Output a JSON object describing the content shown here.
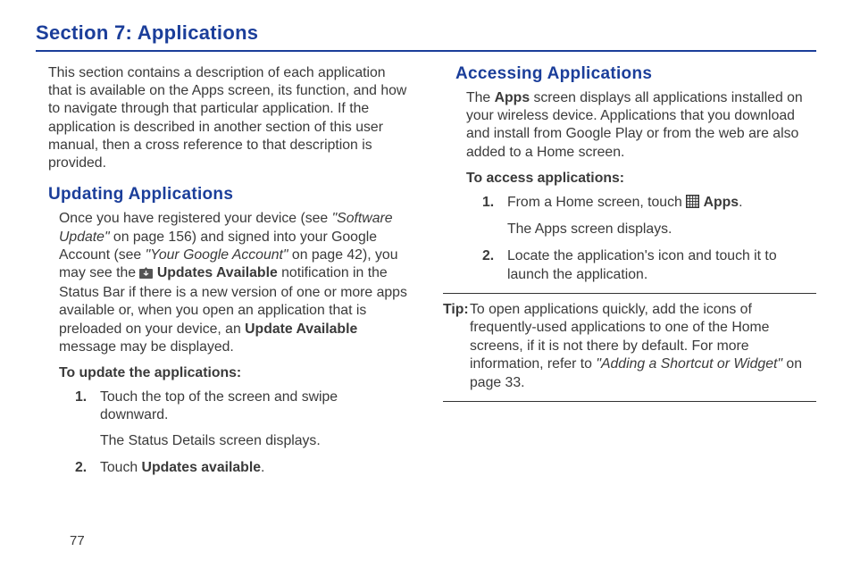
{
  "pageTitle": "Section 7: Applications",
  "intro": "This section contains a description of each application that is available on the Apps screen, its function, and how to navigate through that particular application. If the application is described in another section of this user manual, then a cross reference to that description is provided.",
  "left": {
    "heading": "Updating Applications",
    "para": {
      "seg1": "Once you have registered your device (see ",
      "ref1": "\"Software Update\"",
      "seg2": " on page 156) and signed into your Google Account (see ",
      "ref2": "\"Your Google Account\"",
      "seg3": " on page 42), you may see the ",
      "bold1": "Updates Available",
      "seg4": " notification in the Status Bar if there is a new version of one or more apps available or, when you open an application that is preloaded on your device, an ",
      "bold2": "Update Available",
      "seg5": " message may be displayed."
    },
    "subtitle": "To update the applications:",
    "steps": {
      "n1": "1.",
      "s1a": "Touch the top of the screen and swipe downward.",
      "s1b": "The Status Details screen displays.",
      "n2": "2.",
      "s2pre": "Touch ",
      "s2bold": "Updates available",
      "s2post": "."
    }
  },
  "right": {
    "heading": "Accessing Applications",
    "para": {
      "seg1": "The ",
      "bold1": "Apps",
      "seg2": " screen displays all applications installed on your wireless device. Applications that you download and install from Google Play or from the web are also added to a Home screen."
    },
    "subtitle": "To access applications:",
    "steps": {
      "n1": "1.",
      "s1pre": "From a Home screen, touch ",
      "s1bold": "Apps",
      "s1post": ".",
      "s1b": "The Apps screen displays.",
      "n2": "2.",
      "s2": "Locate the application's icon and touch it to launch the application."
    },
    "tip": {
      "label": "Tip:",
      "seg1": "To open applications quickly, add the icons of frequently-used applications to one of the Home screens, if it is not there by default. For more information, refer to ",
      "ref": "\"Adding a Shortcut or Widget\"",
      "seg2": " on page 33."
    }
  },
  "pageNumber": "77"
}
